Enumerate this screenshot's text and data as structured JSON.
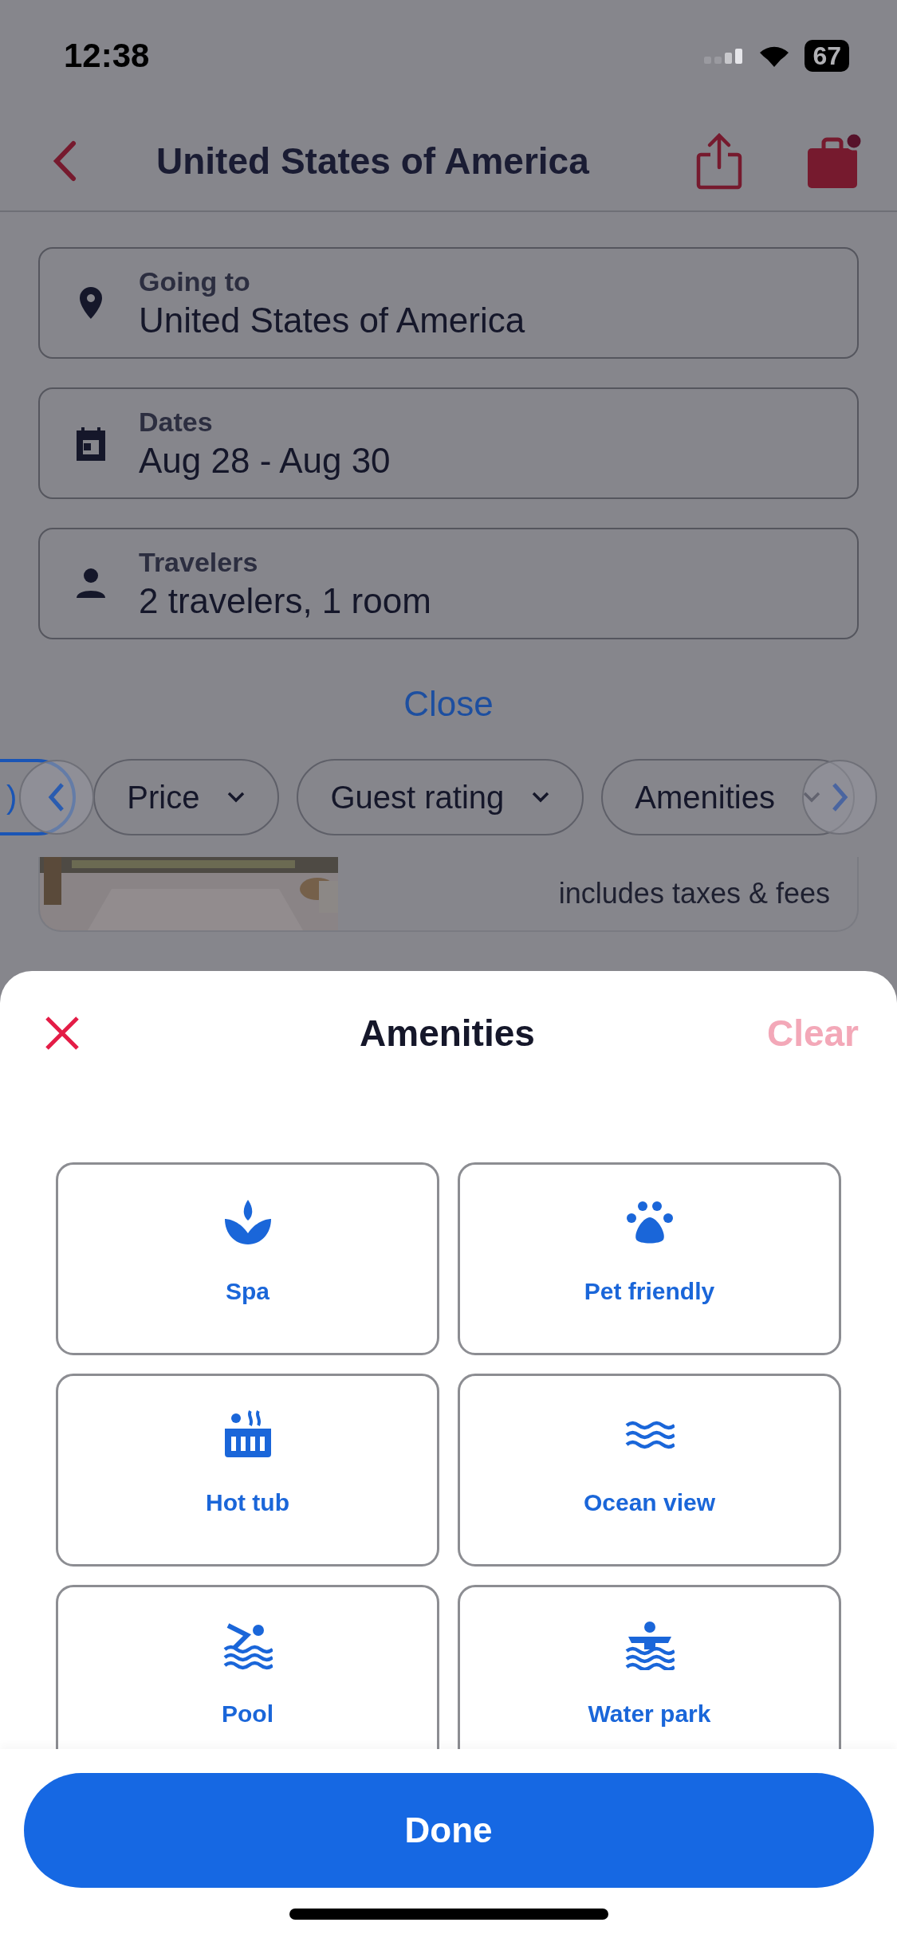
{
  "status_bar": {
    "time": "12:38",
    "battery": "67"
  },
  "header": {
    "title": "United States of America"
  },
  "search_fields": [
    {
      "kind": "location",
      "label": "Going to",
      "value": "United States of America"
    },
    {
      "kind": "dates",
      "label": "Dates",
      "value": "Aug 28 - Aug 30"
    },
    {
      "kind": "travelers",
      "label": "Travelers",
      "value": "2 travelers, 1 room"
    }
  ],
  "close_link": "Close",
  "filter_chips": [
    {
      "label": ")",
      "selected": true
    },
    {
      "label": "Price",
      "selected": false
    },
    {
      "label": "Guest rating",
      "selected": false
    },
    {
      "label": "Amenities",
      "selected": false
    }
  ],
  "result_card": {
    "price_note": "includes taxes & fees"
  },
  "sheet": {
    "title": "Amenities",
    "clear": "Clear",
    "amenities": [
      {
        "kind": "spa",
        "label": "Spa",
        "selected": false
      },
      {
        "kind": "pet",
        "label": "Pet friendly",
        "selected": false
      },
      {
        "kind": "hottub",
        "label": "Hot tub",
        "selected": false
      },
      {
        "kind": "ocean",
        "label": "Ocean view",
        "selected": false
      },
      {
        "kind": "pool",
        "label": "Pool",
        "selected": false
      },
      {
        "kind": "waterpark",
        "label": "Water park",
        "selected": false
      }
    ],
    "done": "Done"
  }
}
